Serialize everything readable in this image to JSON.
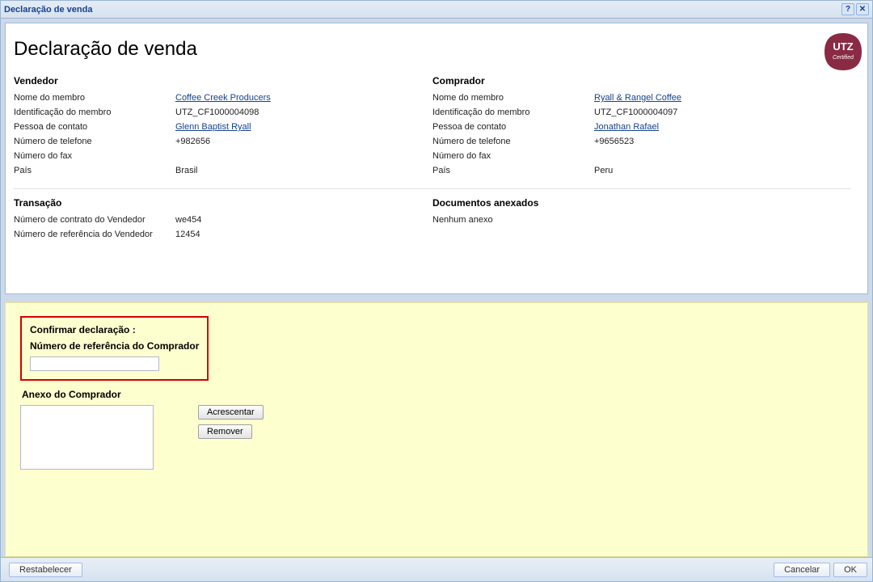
{
  "window": {
    "title": "Declaração de venda"
  },
  "page": {
    "heading": "Declaração de venda"
  },
  "vendor": {
    "heading": "Vendedor",
    "member_name_label": "Nome do membro",
    "member_name": "Coffee Creek Producers",
    "member_id_label": "Identificação do membro",
    "member_id": "UTZ_CF1000004098",
    "contact_label": "Pessoa de contato",
    "contact": "Glenn Baptist Ryall",
    "phone_label": "Número de telefone",
    "phone": "+982656",
    "fax_label": "Número do fax",
    "fax": "",
    "country_label": "País",
    "country": "Brasil"
  },
  "buyer": {
    "heading": "Comprador",
    "member_name_label": "Nome do membro",
    "member_name": "Ryall & Rangel Coffee",
    "member_id_label": "Identificação do membro",
    "member_id": "UTZ_CF1000004097",
    "contact_label": "Pessoa de contato",
    "contact": "Jonathan Rafael",
    "phone_label": "Número de telefone",
    "phone": "+9656523",
    "fax_label": "Número do fax",
    "fax": "",
    "country_label": "País",
    "country": "Peru"
  },
  "transaction": {
    "heading": "Transação",
    "seller_contract_label": "Número de contrato do Vendedor",
    "seller_contract": "we454",
    "seller_ref_label": "Número de referência do Vendedor",
    "seller_ref": "12454"
  },
  "attachments": {
    "heading": "Documentos anexados",
    "none": "Nenhum anexo"
  },
  "confirm": {
    "title": "Confirmar declaração :",
    "buyer_ref_label": "Número de referência do Comprador",
    "buyer_ref_value": "",
    "buyer_attach_label": "Anexo do Comprador",
    "add_btn": "Acrescentar",
    "remove_btn": "Remover"
  },
  "footer": {
    "reset": "Restabelecer",
    "cancel": "Cancelar",
    "ok": "OK"
  },
  "icons": {
    "help": "?",
    "close": "✕"
  },
  "logo": {
    "top": "UTZ",
    "bottom": "Certified",
    "color": "#8a2a44"
  }
}
